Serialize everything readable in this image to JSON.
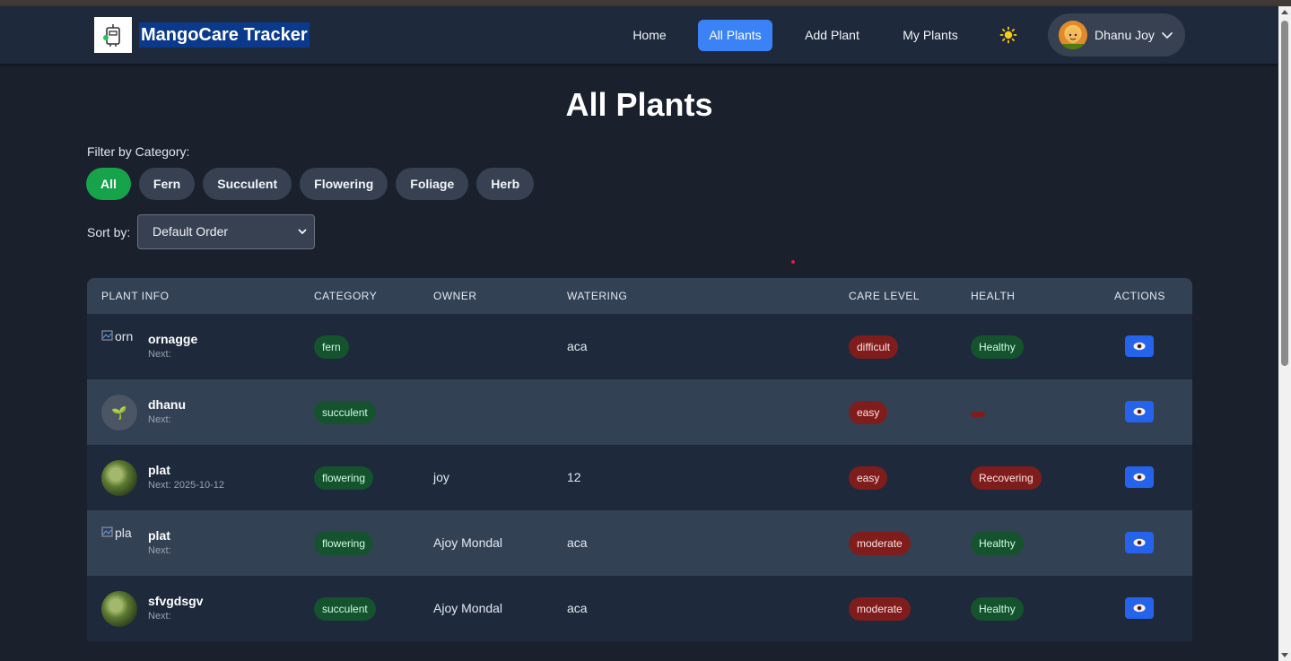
{
  "brand": {
    "title": "MangoCare Tracker"
  },
  "nav": {
    "links": [
      {
        "label": "Home"
      },
      {
        "label": "All Plants"
      },
      {
        "label": "Add Plant"
      },
      {
        "label": "My Plants"
      }
    ],
    "theme_icon": "sun-icon",
    "user": {
      "name": "Dhanu Joy"
    }
  },
  "page": {
    "title": "All Plants"
  },
  "filter": {
    "label": "Filter by Category:",
    "categories": [
      "All",
      "Fern",
      "Succulent",
      "Flowering",
      "Foliage",
      "Herb"
    ],
    "selected": "All"
  },
  "sort": {
    "label": "Sort by:",
    "selected": "Default Order"
  },
  "table": {
    "headers": [
      "PLANT INFO",
      "CATEGORY",
      "OWNER",
      "WATERING",
      "CARE LEVEL",
      "HEALTH",
      "ACTIONS"
    ],
    "rows": [
      {
        "image": "broken",
        "alt": "orn",
        "name": "ornagge",
        "next": "Next:",
        "category": "fern",
        "owner": "",
        "watering": "aca",
        "care": "difficult",
        "health": "Healthy",
        "health_color": "green"
      },
      {
        "image": "placeholder",
        "alt": "🌱",
        "name": "dhanu",
        "next": "Next:",
        "category": "succulent",
        "owner": "",
        "watering": "",
        "care": "easy",
        "health": "",
        "health_color": "red"
      },
      {
        "image": "photo",
        "alt": "",
        "name": "plat",
        "next": "Next: 2025-10-12",
        "category": "flowering",
        "owner": "joy",
        "watering": "12",
        "care": "easy",
        "health": "Recovering",
        "health_color": "red"
      },
      {
        "image": "broken",
        "alt": "pla",
        "name": "plat",
        "next": "Next:",
        "category": "flowering",
        "owner": "Ajoy Mondal",
        "watering": "aca",
        "care": "moderate",
        "health": "Healthy",
        "health_color": "green"
      },
      {
        "image": "photo",
        "alt": "",
        "name": "sfvgdsgv",
        "next": "Next:",
        "category": "succulent",
        "owner": "Ajoy Mondal",
        "watering": "aca",
        "care": "moderate",
        "health": "Healthy",
        "health_color": "green"
      }
    ]
  },
  "colors": {
    "accent": "#3b82f6",
    "success": "#16a34a",
    "badge_green": "#14532d",
    "badge_red": "#7f1d1d",
    "background": "#1a202c"
  }
}
